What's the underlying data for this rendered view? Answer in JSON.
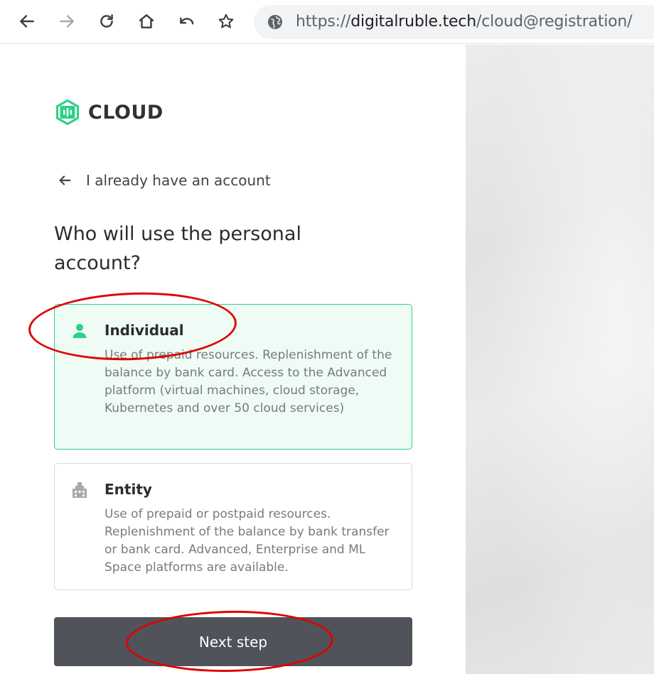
{
  "browser": {
    "url_scheme": "https://",
    "url_domain": "digitalruble.tech",
    "url_path": "/cloud@registration/",
    "icons": [
      "back-arrow-icon",
      "forward-arrow-icon",
      "reload-icon",
      "home-icon",
      "undo-icon",
      "star-icon",
      "globe-icon"
    ]
  },
  "brand": {
    "name": "CLOUD",
    "accent_color": "#2fd08a"
  },
  "back_link": {
    "label": "I already have an account"
  },
  "heading": "Who will use the personal account?",
  "options": [
    {
      "title": "Individual",
      "description": "Use of prepaid resources. Replenishment of the balance by bank card. Access to the Advanced platform (virtual machines, cloud storage, Kubernetes and over 50 cloud services)",
      "icon": "person-icon",
      "selected": true
    },
    {
      "title": "Entity",
      "description": "Use of prepaid or postpaid resources. Replenishment of the balance by bank transfer or bank card. Advanced, Enterprise and ML Space platforms are available.",
      "icon": "building-icon",
      "selected": false
    }
  ],
  "next_button": {
    "label": "Next step",
    "color": "#50535a"
  },
  "annotations": {
    "color": "#e00000"
  }
}
